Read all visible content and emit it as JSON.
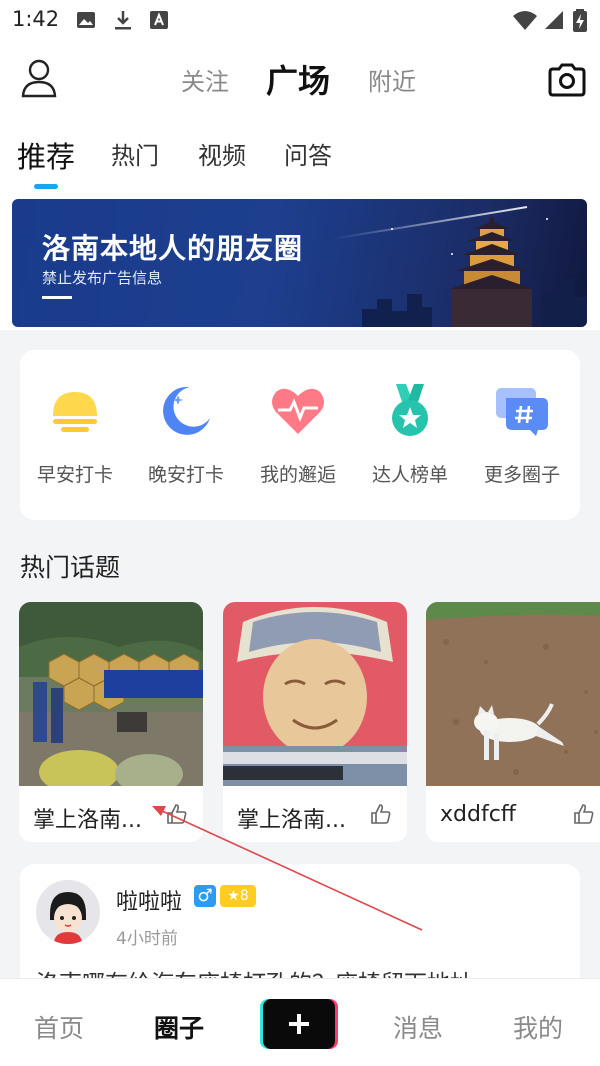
{
  "status_bar": {
    "time": "1:42",
    "icons": [
      "image-icon",
      "download-icon",
      "a-badge-icon",
      "wifi-icon",
      "signal-icon",
      "battery-charging-icon"
    ]
  },
  "header": {
    "top_tabs": [
      {
        "label": "关注",
        "active": false
      },
      {
        "label": "广场",
        "active": true
      },
      {
        "label": "附近",
        "active": false
      }
    ],
    "sub_tabs": [
      {
        "label": "推荐",
        "active": true
      },
      {
        "label": "热门",
        "active": false
      },
      {
        "label": "视频",
        "active": false
      },
      {
        "label": "问答",
        "active": false
      }
    ],
    "accent_color": "#1aa5ef"
  },
  "banner": {
    "title": "洛南本地人的朋友圈",
    "subtitle": "禁止发布广告信息"
  },
  "quick_links": [
    {
      "label": "早安打卡",
      "icon": "sun-icon"
    },
    {
      "label": "晚安打卡",
      "icon": "moon-icon"
    },
    {
      "label": "我的邂逅",
      "icon": "heart-pulse-icon"
    },
    {
      "label": "达人榜单",
      "icon": "medal-icon"
    },
    {
      "label": "更多圈子",
      "icon": "chat-hash-icon"
    }
  ],
  "hot_topics": {
    "title": "热门话题",
    "items": [
      {
        "name": "掌上洛南...",
        "image": "rescue-scene-photo"
      },
      {
        "name": "掌上洛南...",
        "image": "painting-photo"
      },
      {
        "name": "xddfcff",
        "image": "dog-field-photo"
      }
    ]
  },
  "post": {
    "username": "啦啦啦",
    "gender_symbol": "♂",
    "level": "8",
    "time": "4小时前",
    "text": "洛南哪有给汽车座椅打孔的？座椅留下地址"
  },
  "bottom_nav": {
    "items": [
      {
        "label": "首页",
        "active": false
      },
      {
        "label": "圈子",
        "active": true
      },
      {
        "label": "消息",
        "active": false
      },
      {
        "label": "我的",
        "active": false
      }
    ]
  }
}
